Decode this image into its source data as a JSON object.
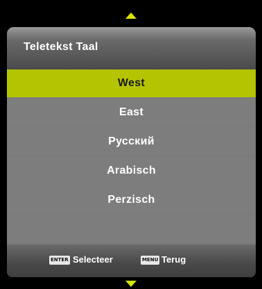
{
  "menu": {
    "title": "Teletekst Taal",
    "items": [
      {
        "label": "West",
        "selected": true
      },
      {
        "label": "East",
        "selected": false
      },
      {
        "label": "Русский",
        "selected": false
      },
      {
        "label": "Arabisch",
        "selected": false
      },
      {
        "label": "Perzisch",
        "selected": false
      }
    ]
  },
  "footer": {
    "enter_key": "ENTER",
    "enter_label": "Selecteer",
    "menu_key": "MENU",
    "menu_label": "Terug"
  },
  "colors": {
    "accent": "#b4c400",
    "arrow": "#d8e400",
    "panel": "#7b7b7b"
  },
  "icons": {
    "scroll_up": "triangle-up-icon",
    "scroll_down": "triangle-down-icon"
  }
}
